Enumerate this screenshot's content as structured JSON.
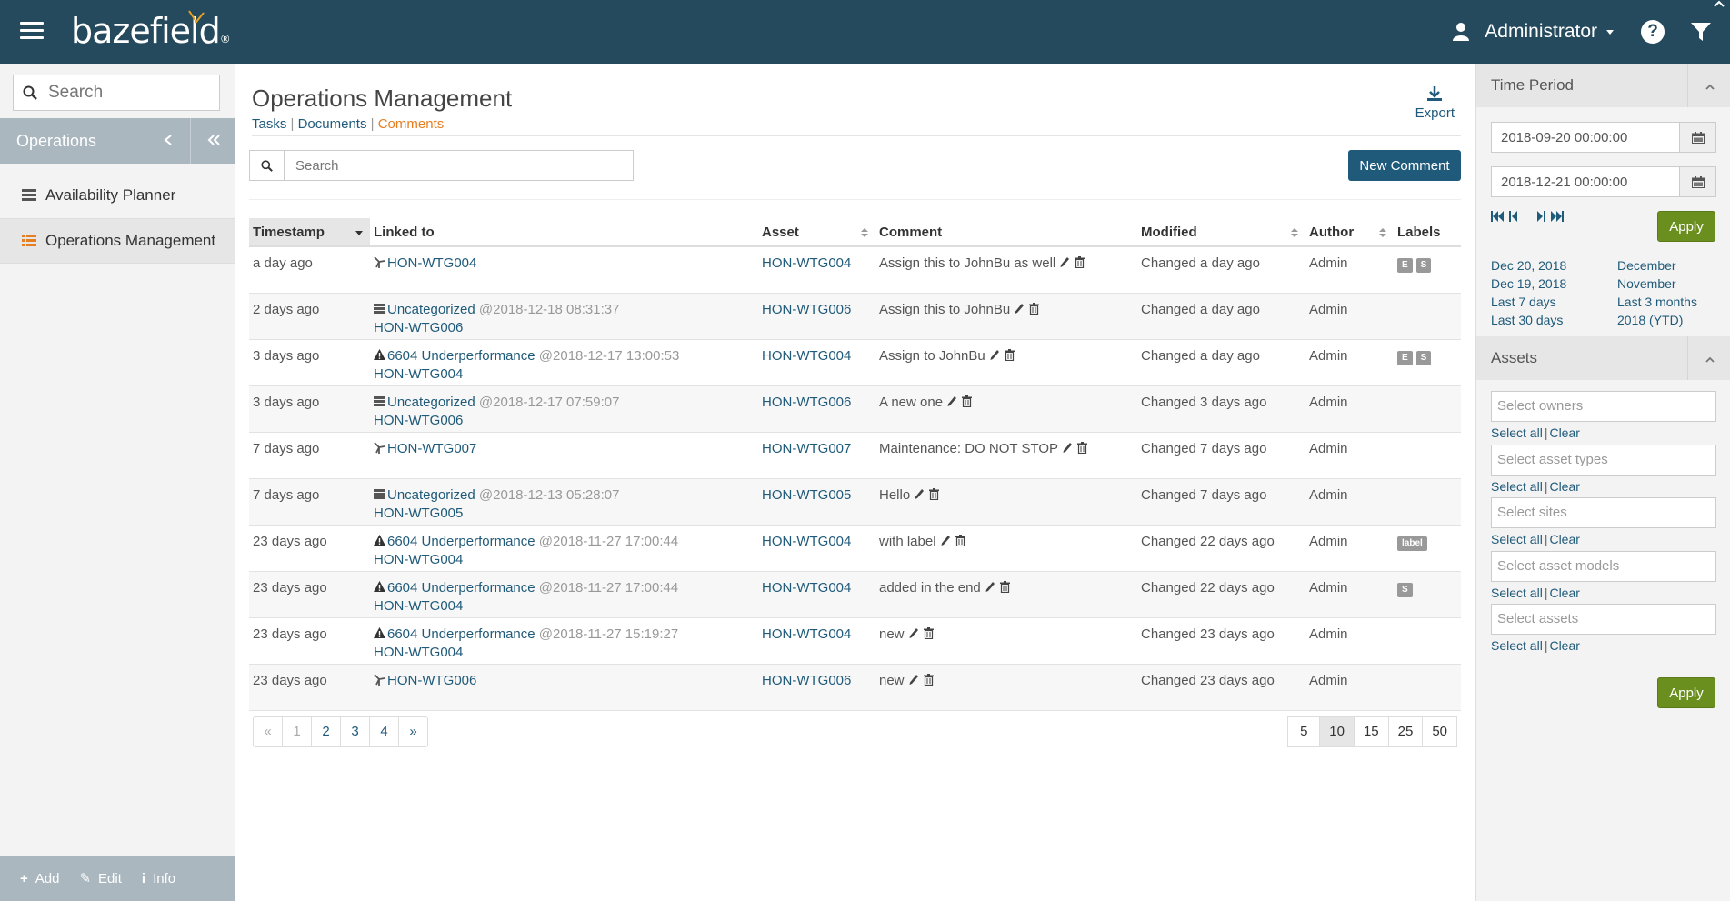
{
  "header": {
    "logo_text": "bazefield",
    "logo_reg": "®",
    "user_name": "Administrator",
    "help_glyph": "?"
  },
  "sidebar": {
    "search_placeholder": "Search",
    "section_label": "Operations",
    "items": [
      {
        "label": "Availability Planner",
        "icon": "server-icon"
      },
      {
        "label": "Operations Management",
        "icon": "list-icon"
      }
    ],
    "footer": [
      {
        "label": "Add",
        "glyph": "+"
      },
      {
        "label": "Edit",
        "glyph": "✎"
      },
      {
        "label": "Info",
        "glyph": "i"
      }
    ]
  },
  "main": {
    "title": "Operations Management",
    "tabs": [
      "Tasks",
      "Documents",
      "Comments"
    ],
    "tab_sep": "|",
    "active_tab": "Comments",
    "export_label": "Export",
    "search_placeholder": "Search",
    "new_button_label": "New Comment",
    "columns": [
      "Timestamp",
      "Linked to",
      "Asset",
      "Comment",
      "Modified",
      "Author",
      "Labels"
    ],
    "rows": [
      {
        "timestamp": "a day ago",
        "link_icon": "turbine-icon",
        "link_text": "HON-WTG004",
        "link_at": "",
        "link_sub": "",
        "asset": "HON-WTG004",
        "comment": "Assign this to JohnBu as well",
        "modified": "Changed a day ago",
        "author": "Admin",
        "labels": [
          "E",
          "S"
        ]
      },
      {
        "timestamp": "2 days ago",
        "link_icon": "server-icon",
        "link_text": "Uncategorized",
        "link_at": "@2018-12-18 08:31:37",
        "link_sub": "HON-WTG006",
        "asset": "HON-WTG006",
        "comment": "Assign this to JohnBu",
        "modified": "Changed a day ago",
        "author": "Admin",
        "labels": []
      },
      {
        "timestamp": "3 days ago",
        "link_icon": "warning-icon",
        "link_text": "6604 Underperformance",
        "link_at": "@2018-12-17 13:00:53",
        "link_sub": "HON-WTG004",
        "asset": "HON-WTG004",
        "comment": "Assign to JohnBu",
        "modified": "Changed a day ago",
        "author": "Admin",
        "labels": [
          "E",
          "S"
        ]
      },
      {
        "timestamp": "3 days ago",
        "link_icon": "server-icon",
        "link_text": "Uncategorized",
        "link_at": "@2018-12-17 07:59:07",
        "link_sub": "HON-WTG006",
        "asset": "HON-WTG006",
        "comment": "A new one",
        "modified": "Changed 3 days ago",
        "author": "Admin",
        "labels": []
      },
      {
        "timestamp": "7 days ago",
        "link_icon": "turbine-icon",
        "link_text": "HON-WTG007",
        "link_at": "",
        "link_sub": "",
        "asset": "HON-WTG007",
        "comment": "Maintenance: DO NOT STOP",
        "modified": "Changed 7 days ago",
        "author": "Admin",
        "labels": []
      },
      {
        "timestamp": "7 days ago",
        "link_icon": "server-icon",
        "link_text": "Uncategorized",
        "link_at": "@2018-12-13 05:28:07",
        "link_sub": "HON-WTG005",
        "asset": "HON-WTG005",
        "comment": "Hello",
        "modified": "Changed 7 days ago",
        "author": "Admin",
        "labels": []
      },
      {
        "timestamp": "23 days ago",
        "link_icon": "warning-icon",
        "link_text": "6604 Underperformance",
        "link_at": "@2018-11-27 17:00:44",
        "link_sub": "HON-WTG004",
        "asset": "HON-WTG004",
        "comment": "with label",
        "modified": "Changed 22 days ago",
        "author": "Admin",
        "labels": [
          "label"
        ]
      },
      {
        "timestamp": "23 days ago",
        "link_icon": "warning-icon",
        "link_text": "6604 Underperformance",
        "link_at": "@2018-11-27 17:00:44",
        "link_sub": "HON-WTG004",
        "asset": "HON-WTG004",
        "comment": "added in the end",
        "modified": "Changed 22 days ago",
        "author": "Admin",
        "labels": [
          "S"
        ]
      },
      {
        "timestamp": "23 days ago",
        "link_icon": "warning-icon",
        "link_text": "6604 Underperformance",
        "link_at": "@2018-11-27 15:19:27",
        "link_sub": "HON-WTG004",
        "asset": "HON-WTG004",
        "comment": "new",
        "modified": "Changed 23 days ago",
        "author": "Admin",
        "labels": []
      },
      {
        "timestamp": "23 days ago",
        "link_icon": "turbine-icon",
        "link_text": "HON-WTG006",
        "link_at": "",
        "link_sub": "",
        "asset": "HON-WTG006",
        "comment": "new",
        "modified": "Changed 23 days ago",
        "author": "Admin",
        "labels": []
      }
    ],
    "pagination": [
      "«",
      "1",
      "2",
      "3",
      "4",
      "»"
    ],
    "page_sizes": [
      "5",
      "10",
      "15",
      "25",
      "50"
    ],
    "active_page_size": "10"
  },
  "right_panel": {
    "time_period_title": "Time Period",
    "start_date": "2018-09-20 00:00:00",
    "end_date": "2018-12-21 00:00:00",
    "apply_label": "Apply",
    "quick_ranges": [
      "Dec 20, 2018",
      "December",
      "Dec 19, 2018",
      "November",
      "Last 7 days",
      "Last 3 months",
      "Last 30 days",
      "2018 (YTD)"
    ],
    "assets_title": "Assets",
    "selects": [
      "Select owners",
      "Select asset types",
      "Select sites",
      "Select asset models",
      "Select assets"
    ],
    "select_all_label": "Select all",
    "clear_label": "Clear",
    "select_sep": "|",
    "assets_apply_label": "Apply"
  },
  "colors": {
    "topbar": "#254a5d",
    "link": "#1f5a7a",
    "active_tab": "#e67e22",
    "apply_green": "#6a8f1f",
    "sidebar_section": "#aab7bf"
  }
}
